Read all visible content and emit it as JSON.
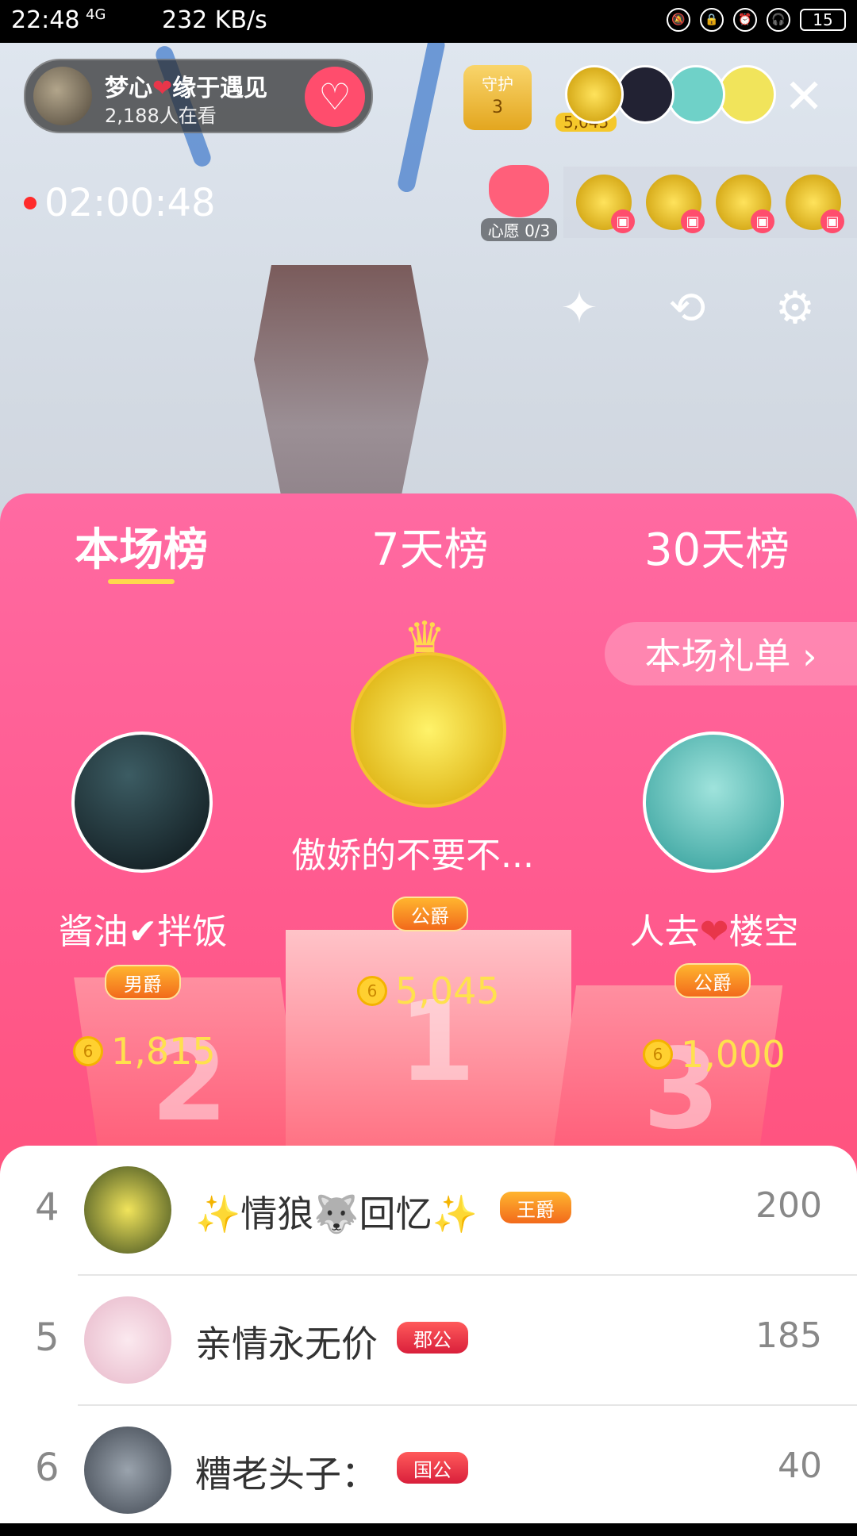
{
  "statusbar": {
    "time": "22:48",
    "network": "4G",
    "speed": "232 KB/s",
    "battery": "15"
  },
  "host": {
    "name_part1": "梦心",
    "name_part2": "缘于遇见",
    "viewers": "2,188人在看"
  },
  "guard": {
    "label": "守护",
    "count": "3"
  },
  "top_fan": {
    "score": "5,045"
  },
  "live": {
    "timer": "02:00:48"
  },
  "wish": {
    "label": "心愿 0/3"
  },
  "panel": {
    "tabs": [
      "本场榜",
      "7天榜",
      "30天榜"
    ],
    "gift_list": "本场礼单 ›"
  },
  "podium": {
    "first": {
      "name": "傲娇的不要不...",
      "badge": "公爵",
      "score": "5,045",
      "rank": "1"
    },
    "second": {
      "name": "酱油✔拌饭",
      "badge": "男爵",
      "score": "1,815",
      "rank": "2"
    },
    "third": {
      "name_part1": "人去",
      "name_part2": "楼空",
      "badge": "公爵",
      "score": "1,000",
      "rank": "3"
    }
  },
  "list": [
    {
      "rank": "4",
      "name": "✨情狼🐺回忆✨",
      "badge": "王爵",
      "score": "200"
    },
    {
      "rank": "5",
      "name": "亲情永无价",
      "badge": "郡公",
      "score": "185"
    },
    {
      "rank": "6",
      "name": "糟老头子：",
      "badge": "国公",
      "score": "40"
    }
  ],
  "colors": {
    "panel_top": "#ff6aa2",
    "panel_bottom": "#ff4b6a",
    "score_gold": "#ffe14d",
    "tab_underline": "#ffd84d"
  }
}
